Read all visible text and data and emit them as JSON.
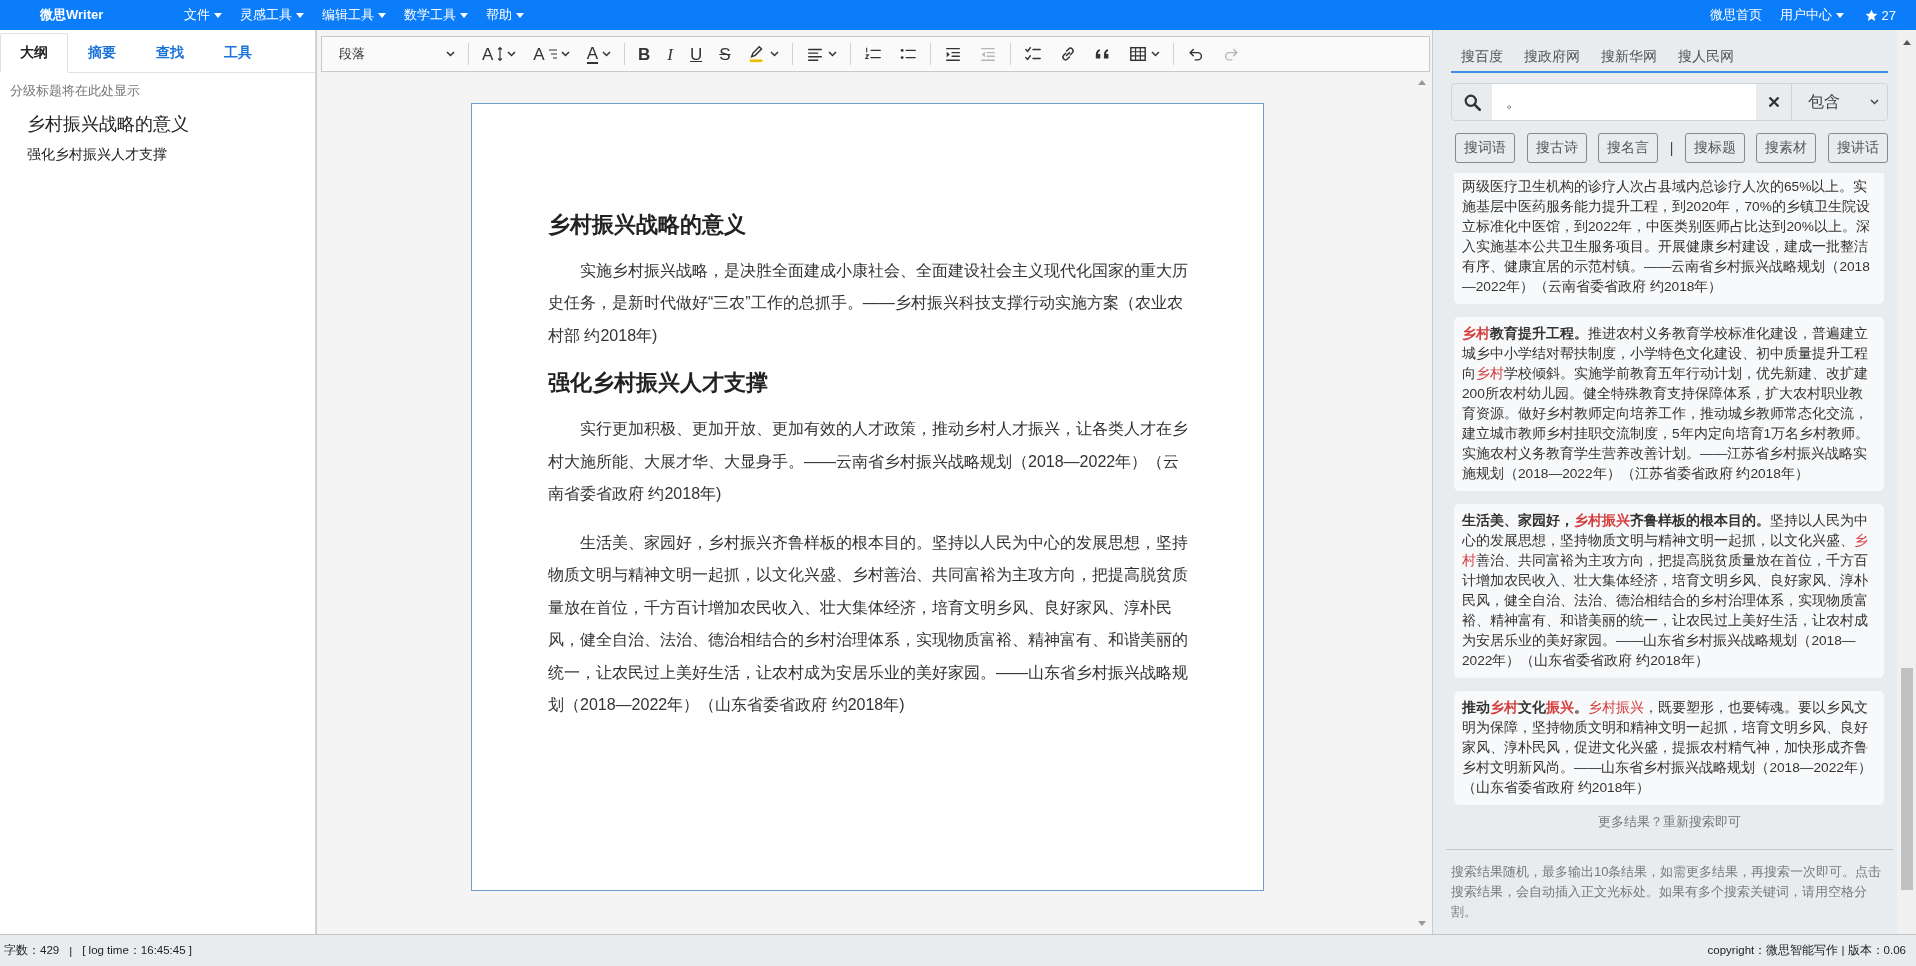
{
  "navbar": {
    "brand": "微思Writer",
    "menus": [
      {
        "label": "文件",
        "caret": true
      },
      {
        "label": "灵感工具",
        "caret": true
      },
      {
        "label": "编辑工具",
        "caret": true
      },
      {
        "label": "数学工具",
        "caret": true
      },
      {
        "label": "帮助",
        "caret": true
      }
    ],
    "right_links": [
      {
        "label": "微思首页"
      },
      {
        "label": "用户中心",
        "caret": true
      }
    ],
    "star_count": "27"
  },
  "outline": {
    "tabs": [
      {
        "label": "大纲",
        "selected": true
      },
      {
        "label": "摘要",
        "selected": false
      },
      {
        "label": "查找",
        "selected": false
      },
      {
        "label": "工具",
        "selected": false
      }
    ],
    "hint": "分级标题将在此处显示",
    "items": [
      {
        "kind": "heading-1",
        "text": "乡村振兴战略的意义"
      },
      {
        "kind": "heading-2",
        "text": "强化乡村振兴人才支撑"
      }
    ]
  },
  "editor": {
    "toolbar": {
      "groups": [
        [
          {
            "kind": "dropdown",
            "text": "段落",
            "caret": true,
            "disabled": false
          }
        ],
        [
          {
            "kind": "font-size",
            "text": "A",
            "caret": true,
            "disabled": false
          },
          {
            "kind": "font-family",
            "text": "A",
            "caret": true,
            "disabled": false
          },
          {
            "kind": "font-color",
            "text": "A",
            "caret": true,
            "disabled": false
          }
        ],
        [
          {
            "kind": "bold",
            "text": "B",
            "disabled": false
          },
          {
            "kind": "italic",
            "text": "I",
            "disabled": false
          },
          {
            "kind": "underline",
            "text": "U",
            "disabled": false
          },
          {
            "kind": "strikethrough",
            "text": "S",
            "disabled": false
          },
          {
            "kind": "highlight",
            "caret": true,
            "disabled": false
          }
        ],
        [
          {
            "kind": "align",
            "caret": true,
            "disabled": false
          }
        ],
        [
          {
            "kind": "numbered-list",
            "disabled": false
          },
          {
            "kind": "bulleted-list",
            "disabled": false
          }
        ],
        [
          {
            "kind": "indent",
            "disabled": false
          },
          {
            "kind": "outdent",
            "disabled": true
          }
        ],
        [
          {
            "kind": "todo-list",
            "disabled": false
          },
          {
            "kind": "link",
            "disabled": false
          },
          {
            "kind": "blockquote",
            "disabled": false
          },
          {
            "kind": "table",
            "caret": true,
            "disabled": false
          }
        ],
        [
          {
            "kind": "undo",
            "disabled": false
          },
          {
            "kind": "redo",
            "disabled": true
          }
        ]
      ]
    },
    "document": [
      {
        "kind": "heading",
        "text": "乡村振兴战略的意义"
      },
      {
        "kind": "paragraph",
        "text": "实施乡村振兴战略，是决胜全面建成小康社会、全面建设社会主义现代化国家的重大历史任务，是新时代做好“三农”工作的总抓手。——乡村振兴科技支撑行动实施方案（农业农村部 约2018年)"
      },
      {
        "kind": "heading",
        "text": "强化乡村振兴人才支撑"
      },
      {
        "kind": "paragraph",
        "text": "实行更加积极、更加开放、更加有效的人才政策，推动乡村人才振兴，让各类人才在乡村大施所能、大展才华、大显身手。——云南省乡村振兴战略规划（2018—2022年）（云南省委省政府 约2018年)"
      },
      {
        "kind": "paragraph",
        "text": "生活美、家园好，乡村振兴齐鲁样板的根本目的。坚持以人民为中心的发展思想，坚持物质文明与精神文明一起抓，以文化兴盛、乡村善治、共同富裕为主攻方向，把提高脱贫质量放在首位，千方百计增加农民收入、壮大集体经济，培育文明乡风、良好家风、淳朴民风，健全自治、法治、德治相结合的乡村治理体系，实现物质富裕、精神富有、和谐美丽的统一，让农民过上美好生活，让农村成为安居乐业的美好家园。——山东省乡村振兴战略规划（2018—2022年）（山东省委省政府 约2018年)"
      }
    ]
  },
  "search": {
    "tabs": [
      "搜百度",
      "搜政府网",
      "搜新华网",
      "搜人民网"
    ],
    "query": "。",
    "match_mode": "包含",
    "buttons": [
      {
        "kind": "button",
        "label": "搜词语"
      },
      {
        "kind": "button",
        "label": "搜古诗"
      },
      {
        "kind": "button",
        "label": "搜名言"
      },
      {
        "kind": "divider",
        "label": "|"
      },
      {
        "kind": "button",
        "label": "搜标题"
      },
      {
        "kind": "button",
        "label": "搜素材"
      },
      {
        "kind": "button",
        "label": "搜讲话"
      }
    ],
    "results": [
      {
        "segments": [
          {
            "text": "两级医疗卫生机构的诊疗人次占县域内总诊疗人次的65%以上。实施基层中医药服务能力提升工程，到2020年，70%的乡镇卫生院设立标准化中医馆，到2022年，中医类别医师占比达到20%以上。深入实施基本公共卫生服务项目。开展健康乡村建设，建成一批整洁有序、健康宜居的示范村镇。——云南省乡村振兴战略规划（2018—2022年）（云南省委省政府 约2018年）",
            "bold": false,
            "highlight": false
          }
        ]
      },
      {
        "segments": [
          {
            "text": "乡村",
            "bold": true,
            "highlight": true
          },
          {
            "text": "教育提升工程。",
            "bold": true,
            "highlight": false
          },
          {
            "text": "推进农村义务教育学校标准化建设，普遍建立城乡中小学结对帮扶制度，小学特色文化建设、初中质量提升工程向",
            "bold": false,
            "highlight": false
          },
          {
            "text": "乡村",
            "bold": false,
            "highlight": true
          },
          {
            "text": "学校倾斜。实施学前教育五年行动计划，优先新建、改扩建200所农村幼儿园。健全特殊教育支持保障体系，扩大农村职业教育资源。做好乡村教师定向培养工作，推动城乡教师常态化交流，建立城市教师乡村挂职交流制度，5年内定向培育1万名乡村教师。实施农村义务教育学生营养改善计划。——江苏省乡村振兴战略实施规划（2018—2022年）（江苏省委省政府 约2018年）",
            "bold": false,
            "highlight": false
          }
        ]
      },
      {
        "segments": [
          {
            "text": "生活美、家园好，",
            "bold": true,
            "highlight": false
          },
          {
            "text": "乡村振兴",
            "bold": true,
            "highlight": true
          },
          {
            "text": "齐鲁样板的根本目的。",
            "bold": true,
            "highlight": false
          },
          {
            "text": "坚持以人民为中心的发展思想，坚持物质文明与精神文明一起抓，以文化兴盛、",
            "bold": false,
            "highlight": false
          },
          {
            "text": "乡村",
            "bold": false,
            "highlight": true
          },
          {
            "text": "善治、共同富裕为主攻方向，把提高脱贫质量放在首位，千方百计增加农民收入、壮大集体经济，培育文明乡风、良好家风、淳朴民风，健全自治、法治、德治相结合的乡村治理体系，实现物质富裕、精神富有、和谐美丽的统一，让农民过上美好生活，让农村成为安居乐业的美好家园。——山东省乡村振兴战略规划（2018—2022年）（山东省委省政府 约2018年）",
            "bold": false,
            "highlight": false
          }
        ]
      },
      {
        "segments": [
          {
            "text": "推动",
            "bold": true,
            "highlight": false
          },
          {
            "text": "乡村",
            "bold": true,
            "highlight": true
          },
          {
            "text": "文化",
            "bold": true,
            "highlight": false
          },
          {
            "text": "振兴",
            "bold": true,
            "highlight": true
          },
          {
            "text": "。",
            "bold": true,
            "highlight": false
          },
          {
            "text": "乡村振兴",
            "bold": false,
            "highlight": true
          },
          {
            "text": "，既要塑形，也要铸魂。要以乡风文明为保障，坚持物质文明和精神文明一起抓，培育文明乡风、良好家风、淳朴民风，促进文化兴盛，提振农村精气神，加快形成齐鲁乡村文明新风尚。——山东省乡村振兴战略规划（2018—2022年）（山东省委省政府 约2018年）",
            "bold": false,
            "highlight": false
          }
        ]
      }
    ],
    "more_hint": "更多结果？重新搜索即可",
    "help": "搜索结果随机，最多输出10条结果，如需更多结果，再搜索一次即可。点击搜索结果，会自动插入正文光标处。如果有多个搜索关键词，请用空格分割。"
  },
  "status_bar": {
    "word_count": "字数：429",
    "separator": "|",
    "log_time": "[ log time：16:45:45 ]",
    "copyright": "copyright：微思智能写作 | 版本：0.06"
  }
}
